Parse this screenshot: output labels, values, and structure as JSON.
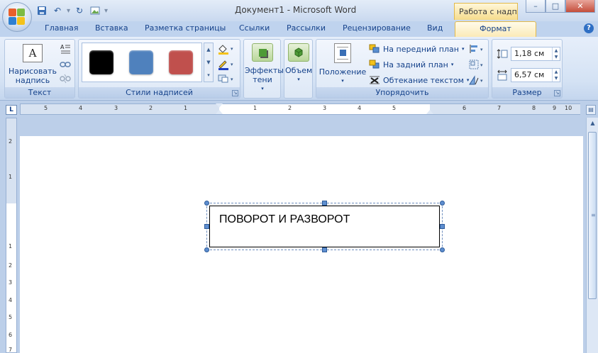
{
  "window": {
    "title": "Документ1 - Microsoft Word",
    "context_tab_title": "Работа с надп...",
    "controls": {
      "minimize": "–",
      "maximize": "□",
      "close": "✕"
    }
  },
  "tabs": [
    {
      "label": "Главная"
    },
    {
      "label": "Вставка"
    },
    {
      "label": "Разметка страницы"
    },
    {
      "label": "Ссылки"
    },
    {
      "label": "Рассылки"
    },
    {
      "label": "Рецензирование"
    },
    {
      "label": "Вид"
    },
    {
      "label": "Формат",
      "active": true
    }
  ],
  "help_label": "?",
  "ribbon": {
    "text_group": {
      "label": "Текст",
      "draw_button_line1": "Нарисовать",
      "draw_button_line2": "надпись",
      "draw_button_icon_text": "A"
    },
    "styles_group": {
      "label": "Стили надписей",
      "swatches": [
        "#000000",
        "#4f81bd",
        "#c0504d"
      ]
    },
    "shadow_group": {
      "line1": "Эффекты",
      "line2": "тени"
    },
    "volume_group": {
      "line1": "Объем"
    },
    "arrange_group": {
      "label": "Упорядочить",
      "position_label": "Положение",
      "bring_front_label": "На передний план",
      "send_back_label": "На задний план",
      "wrap_label": "Обтекание текстом"
    },
    "size_group": {
      "label": "Размер",
      "height_value": "1,18 см",
      "width_value": "6,57 см"
    }
  },
  "ruler": {
    "corner_label": "L",
    "labels": [
      "5",
      "4",
      "3",
      "2",
      "1",
      "1",
      "2",
      "3",
      "4",
      "5",
      "6",
      "7",
      "8",
      "9",
      "10"
    ],
    "vertical_labels": [
      "2",
      "1",
      "1",
      "2",
      "3",
      "4",
      "5",
      "6",
      "7"
    ]
  },
  "document": {
    "textbox_text": "ПОВОРОТ И РАЗВОРОТ"
  },
  "colors": {
    "ribbon_text": "#15428b",
    "active_tab": "#fbeab7",
    "handle": "#5e8ecf"
  }
}
